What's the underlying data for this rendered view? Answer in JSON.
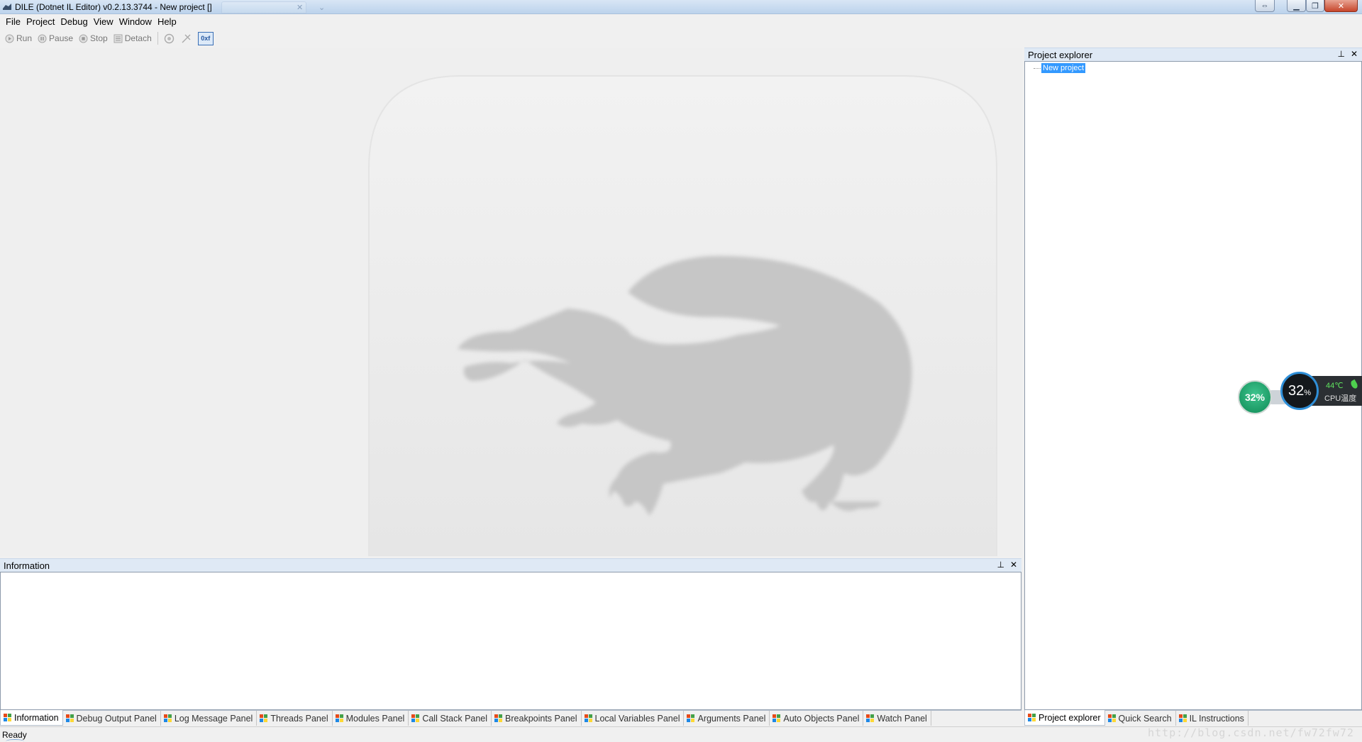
{
  "window": {
    "title": "DILE (Dotnet IL Editor) v0.2.13.3744 - New project []"
  },
  "menu": {
    "items": [
      "File",
      "Project",
      "Debug",
      "View",
      "Window",
      "Help"
    ]
  },
  "toolbar": {
    "run_label": "Run",
    "pause_label": "Pause",
    "stop_label": "Stop",
    "detach_label": "Detach",
    "hex_label": "0xf"
  },
  "info_panel": {
    "title": "Information"
  },
  "bottom_tabs": [
    "Information",
    "Debug Output Panel",
    "Log Message Panel",
    "Threads Panel",
    "Modules Panel",
    "Call Stack Panel",
    "Breakpoints Panel",
    "Local Variables Panel",
    "Arguments Panel",
    "Auto Objects Panel",
    "Watch Panel"
  ],
  "explorer": {
    "title": "Project explorer",
    "tree_root": "New project"
  },
  "right_tabs": [
    "Project explorer",
    "Quick Search",
    "IL Instructions"
  ],
  "cpu_widget": {
    "usage_small": "32%",
    "usage_big": "32",
    "usage_big_unit": "%",
    "temperature": "44℃",
    "temperature_label": "CPU温度"
  },
  "status": {
    "text": "Ready",
    "watermark": "http://blog.csdn.net/fw72fw72"
  },
  "colors": {
    "titlebar": "#bcd3ec",
    "panel_header": "#dfe9f5",
    "selection": "#3399ff",
    "watermark_shape": "#c6c6c6"
  }
}
